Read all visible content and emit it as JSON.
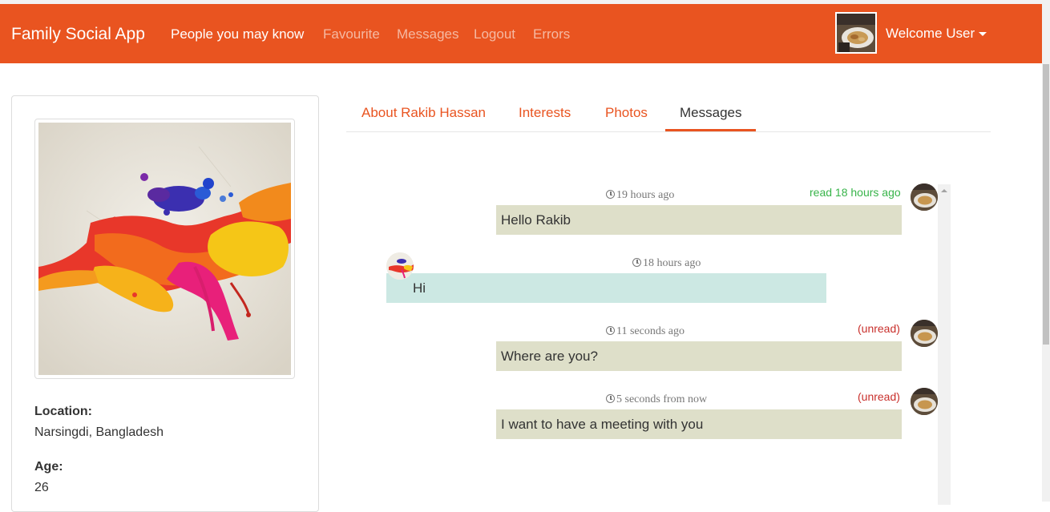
{
  "navbar": {
    "brand": "Family Social App",
    "links": [
      "People you may know",
      "Favourite",
      "Messages",
      "Logout",
      "Errors"
    ],
    "active_link": "People you may know",
    "welcome": "Welcome User",
    "colors": {
      "brand_bg": "#e95420",
      "link_muted": "#f5b9a2",
      "link_active": "#ffffff"
    }
  },
  "profile": {
    "photo_icon": "paint-splash-image",
    "location_label": "Location:",
    "location_value": "Narsingdi, Bangladesh",
    "age_label": "Age:",
    "age_value": "26"
  },
  "tabs": {
    "items": [
      "About Rakib Hassan",
      "Interests",
      "Photos",
      "Messages"
    ],
    "active": "Messages"
  },
  "messages": [
    {
      "direction": "sent",
      "time": "19 hours ago",
      "status": "read 18 hours ago",
      "status_type": "read",
      "text": "Hello Rakib"
    },
    {
      "direction": "received",
      "time": "18 hours ago",
      "status": "",
      "status_type": "",
      "text": "Hi"
    },
    {
      "direction": "sent",
      "time": "11 seconds ago",
      "status": "(unread)",
      "status_type": "unread",
      "text": "Where are you?"
    },
    {
      "direction": "sent",
      "time": "5 seconds from now",
      "status": "(unread)",
      "status_type": "unread",
      "text": "I want to have a meeting with you"
    }
  ],
  "colors": {
    "sent_bubble": "#dedfc9",
    "received_bubble": "#cce8e3",
    "read_status": "#38b44a",
    "unread_status": "#c9302c"
  }
}
